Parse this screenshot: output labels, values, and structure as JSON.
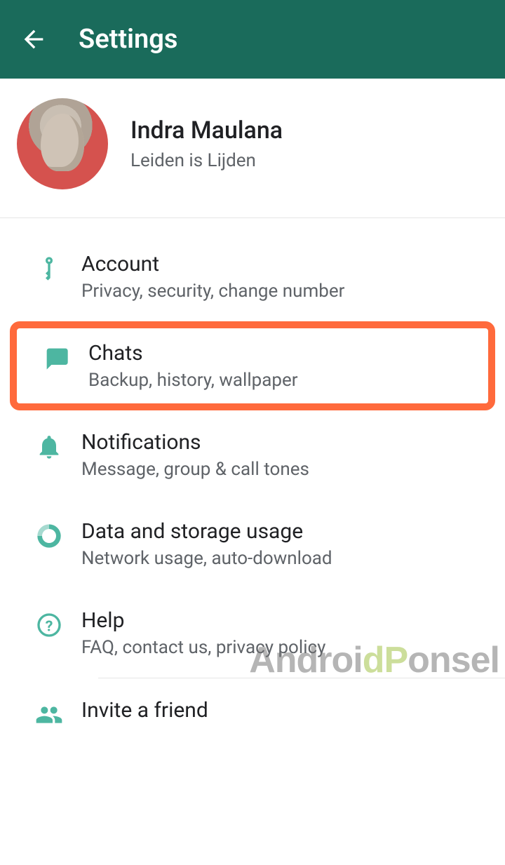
{
  "header": {
    "title": "Settings"
  },
  "profile": {
    "name": "Indra Maulana",
    "status": "Leiden is Lijden"
  },
  "items": [
    {
      "title": "Account",
      "subtitle": "Privacy, security, change number"
    },
    {
      "title": "Chats",
      "subtitle": "Backup, history, wallpaper"
    },
    {
      "title": "Notifications",
      "subtitle": "Message, group & call tones"
    },
    {
      "title": "Data and storage usage",
      "subtitle": "Network usage, auto-download"
    },
    {
      "title": "Help",
      "subtitle": "FAQ, contact us, privacy policy"
    },
    {
      "title": "Invite a friend",
      "subtitle": ""
    }
  ],
  "watermark": "AndroidPonsel",
  "colors": {
    "accent": "#1a6b5b",
    "iconTeal": "#4db6a1",
    "highlight": "#ff6a3c"
  }
}
